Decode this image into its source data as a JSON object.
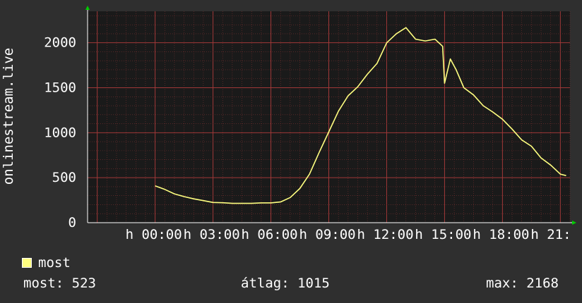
{
  "chart_data": {
    "type": "line",
    "ylabel": "onlinestream.live",
    "xlabel": "",
    "ylim": [
      0,
      2350
    ],
    "y_ticks": [
      "0",
      "500",
      "1000",
      "1500",
      "2000"
    ],
    "x_tick_labels": [
      "h 00:00",
      "h 03:00",
      "h 06:00",
      "h 09:00",
      "h 12:00",
      "h 15:00",
      "h 18:00",
      "h 21:"
    ],
    "colors": {
      "background": "#2f2f2f",
      "plot": "#1a1a1a",
      "grid": "#7a3030",
      "line": "#ffff80",
      "axis": "#ffffff",
      "arrow": "#00cc00"
    },
    "series": [
      {
        "name": "most",
        "x": [
          0,
          0.5,
          1,
          1.5,
          2,
          2.5,
          3,
          3.5,
          4,
          4.5,
          5,
          5.5,
          6,
          6.5,
          7,
          7.5,
          8,
          8.5,
          9,
          9.5,
          10,
          10.5,
          11,
          11.5,
          12,
          12.5,
          13,
          13.5,
          14,
          14.5,
          14.8,
          14.9,
          15,
          15.3,
          15.6,
          16,
          16.5,
          17,
          17.5,
          18,
          18.5,
          19,
          19.5,
          20,
          20.5,
          21,
          21.3
        ],
        "values": [
          410,
          370,
          320,
          290,
          265,
          245,
          225,
          222,
          215,
          215,
          215,
          220,
          220,
          230,
          280,
          380,
          540,
          780,
          1010,
          1240,
          1410,
          1510,
          1650,
          1770,
          2000,
          2100,
          2168,
          2040,
          2020,
          2040,
          1980,
          1960,
          1550,
          1820,
          1700,
          1500,
          1420,
          1300,
          1230,
          1150,
          1040,
          920,
          850,
          720,
          640,
          540,
          523
        ]
      }
    ],
    "grid": true
  },
  "legend": {
    "label": "most"
  },
  "stats": {
    "now": "most: 523",
    "avg": "átlag: 1015",
    "max": "max: 2168"
  }
}
